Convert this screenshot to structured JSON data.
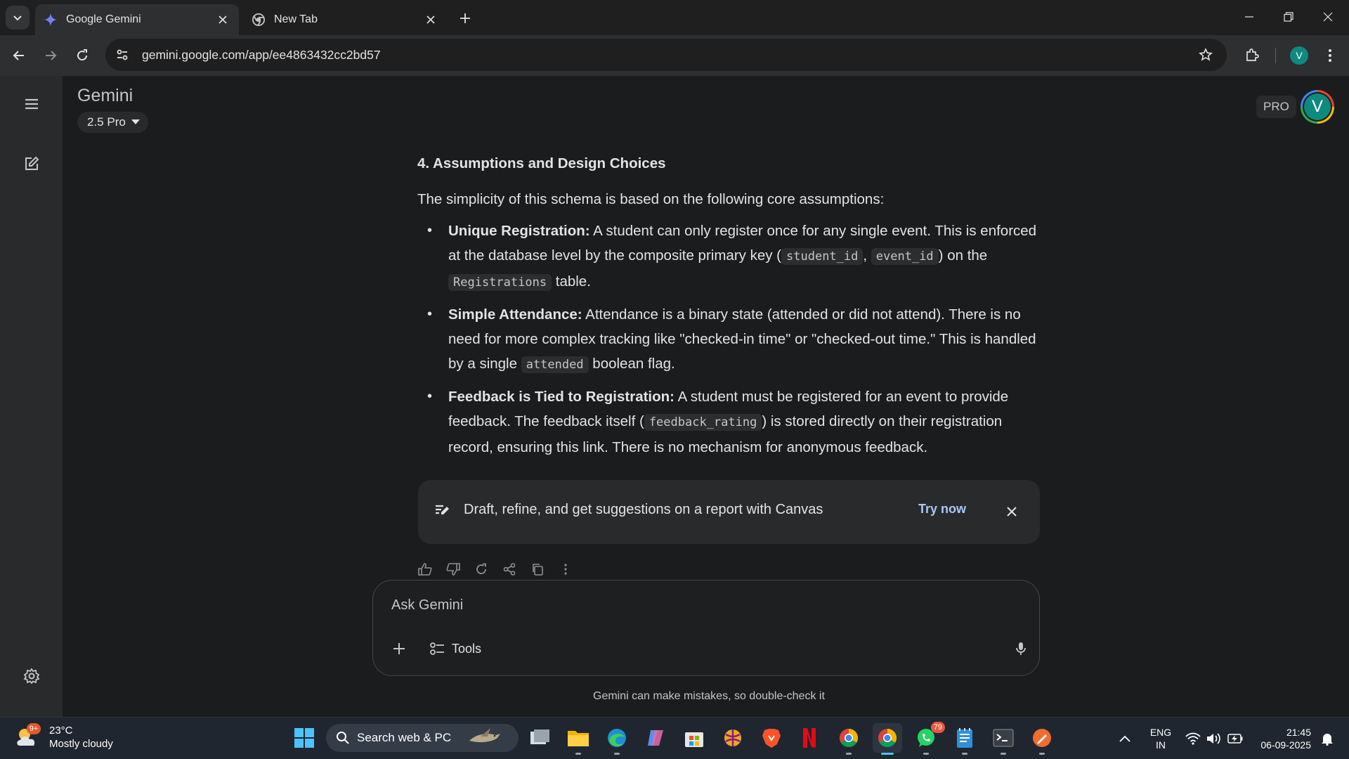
{
  "browser": {
    "tabs": [
      {
        "title": "Google Gemini",
        "active": true
      },
      {
        "title": "New Tab",
        "active": false
      }
    ],
    "url": "gemini.google.com/app/ee4863432cc2bd57",
    "profile_initial": "V"
  },
  "app": {
    "title": "Gemini",
    "model": "2.5 Pro",
    "pro_badge": "PRO",
    "avatar_initial": "V"
  },
  "response": {
    "heading": "4. Assumptions and Design Choices",
    "intro": "The simplicity of this schema is based on the following core assumptions:",
    "items": [
      {
        "title": "Unique Registration:",
        "t1": " A student can only register once for any single event. This is enforced at the database level by the composite primary key (",
        "c1": "student_id",
        "t2": ", ",
        "c2": "event_id",
        "t3": ") on the ",
        "c3": "Registrations",
        "t4": " table."
      },
      {
        "title": "Simple Attendance:",
        "t1": " Attendance is a binary state (attended or did not attend). There is no need for more complex tracking like \"checked-in time\" or \"checked-out time.\" This is handled by a single ",
        "c1": "attended",
        "t2": " boolean flag."
      },
      {
        "title": "Feedback is Tied to Registration:",
        "t1": " A student must be registered for an event to provide feedback. The feedback itself (",
        "c1": "feedback_rating",
        "t2": ") is stored directly on their registration record, ensuring this link. There is no mechanism for anonymous feedback."
      }
    ]
  },
  "canvas_banner": {
    "text": "Draft, refine, and get suggestions on a report with Canvas",
    "action": "Try now"
  },
  "composer": {
    "placeholder": "Ask Gemini",
    "tools_label": "Tools"
  },
  "disclaimer": "Gemini can make mistakes, so double-check it",
  "taskbar": {
    "weather_temp": "23°C",
    "weather_desc": "Mostly cloudy",
    "weather_badge": "9+",
    "search_label": "Search web & PC",
    "whatsapp_badge": "79",
    "lang_line1": "ENG",
    "lang_line2": "IN",
    "time": "21:45",
    "date": "06-09-2025"
  },
  "colors": {
    "accent": "#a8c7fa",
    "background": "#1b1c1d",
    "rail": "#282a2c",
    "avatar": "#0f8a7f"
  }
}
